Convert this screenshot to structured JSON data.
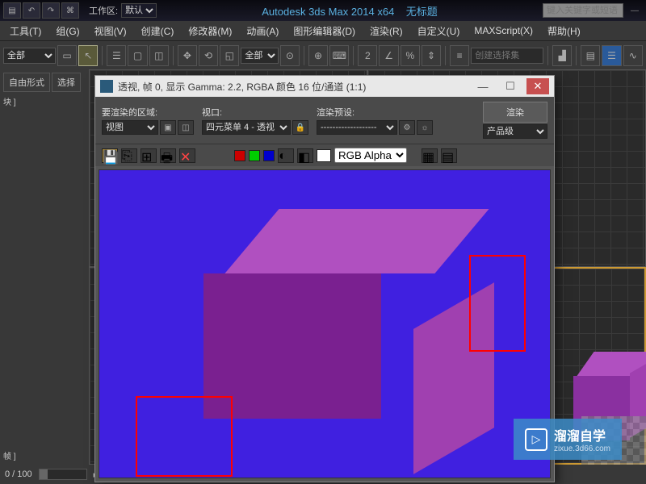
{
  "titlebar": {
    "workspace_label": "工作区:",
    "workspace_value": "默认",
    "app_title": "Autodesk 3ds Max 2014 x64",
    "doc_title": "无标题",
    "search_placeholder": "键入关键字或短语"
  },
  "menus": [
    "工具(T)",
    "组(G)",
    "视图(V)",
    "创建(C)",
    "修改器(M)",
    "动画(A)",
    "图形编辑器(D)",
    "渲染(R)",
    "自定义(U)",
    "MAXScript(X)",
    "帮助(H)"
  ],
  "toolbar": {
    "filter_all": "全部",
    "selection_set_label": "创建选择集"
  },
  "sidebar": {
    "tab1": "自由形式",
    "tab2": "选择",
    "label_s": "块 ]",
    "label_f": "帧 ]"
  },
  "render_window": {
    "title": "透视, 帧 0, 显示 Gamma: 2.2, RGBA 颜色 16 位/通道 (1:1)",
    "area_label": "要渲染的区域:",
    "area_value": "视图",
    "viewport_label": "视口:",
    "viewport_value": "四元菜单 4 - 透视",
    "preset_label": "渲染预设:",
    "preset_value": "-------------------",
    "render_btn": "渲染",
    "production_value": "产品级",
    "channel_value": "RGB Alpha",
    "swatches": [
      "#cc0000",
      "#00cc00",
      "#0000cc"
    ]
  },
  "statusbar": {
    "frame": "0 / 100"
  },
  "watermark": {
    "brand": "溜溜自学",
    "url": "zixue.3d66.com"
  }
}
